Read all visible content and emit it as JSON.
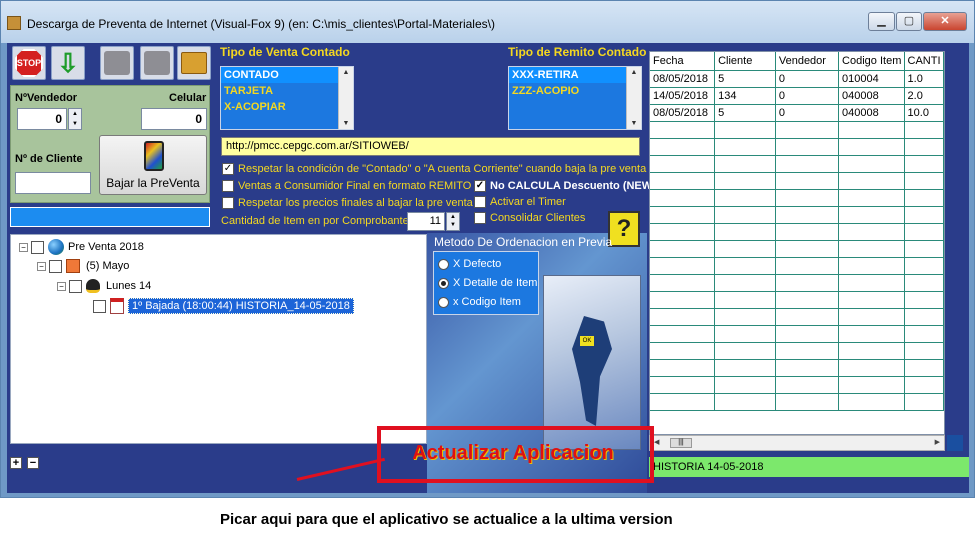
{
  "window": {
    "title": "Descarga de Preventa de Internet (Visual-Fox 9) (en: C:\\mis_clientes\\Portal-Materiales\\)",
    "min": "▁",
    "max": "▢",
    "close": "✕"
  },
  "toolbar": {
    "stop_label": "STOP",
    "download_glyph": "⇩"
  },
  "left_panel": {
    "vendedor_label": "NºVendedor",
    "vendedor_value": "0",
    "celular_label": "Celular",
    "celular_value": "0",
    "cliente_label": "Nº de Cliente",
    "cliente_value": "",
    "bajar_label": "Bajar la PreVenta"
  },
  "tipo_venta": {
    "title": "Tipo de Venta Contado",
    "items": [
      "CONTADO",
      "TARJETA",
      "X-ACOPIAR"
    ]
  },
  "tipo_remito": {
    "title": "Tipo de Remito Contado",
    "items": [
      "XXX-RETIRA",
      "ZZZ-ACOPIO"
    ]
  },
  "url": "http://pmcc.cepgc.com.ar/SITIOWEB/",
  "options": {
    "respetar_condicion": "Respetar la condición de \"Contado\" o \"A cuenta Corriente\" cuando baja la pre venta",
    "ventas_cf": "Ventas a Consumidor Final  en formato REMITO",
    "no_calcula": "No CALCULA Descuento (NEW)",
    "respetar_precios": "Respetar los precios finales al bajar la pre venta",
    "activar_timer": "Activar el Timer",
    "cantidad_label": "Cantidad de Item en por Comprobante",
    "cantidad_value": "11",
    "consolidar": "Consolidar Clientes",
    "help_glyph": "?"
  },
  "tree": {
    "root": "Pre Venta 2018",
    "month": "(5) Mayo",
    "day": "Lunes 14",
    "entry": "1º  Bajada (18:00:44) HISTORIA_14-05-2018",
    "plus": "+",
    "minus": "−"
  },
  "orden": {
    "title": "Metodo De Ordenacion en Previa",
    "options": [
      "X Defecto",
      "X Detalle de Item",
      "x Codigo Item"
    ],
    "selected_index": 1,
    "map_badge": "OK"
  },
  "grid": {
    "columns": [
      "Fecha",
      "Cliente",
      "Vendedor",
      "Codigo Item",
      "CANTI"
    ],
    "rows": [
      [
        "08/05/2018",
        "5",
        "0",
        "010004",
        "1.0"
      ],
      [
        "14/05/2018",
        "134",
        "0",
        "040008",
        "2.0"
      ],
      [
        "08/05/2018",
        "5",
        "0",
        "040008",
        "10.0"
      ]
    ],
    "empty_rows": 17
  },
  "status": "HISTORIA  14-05-2018",
  "update_button": "Actualizar Aplicacion",
  "annotation": "Picar aqui para que el aplicativo se actualice a la ultima version"
}
